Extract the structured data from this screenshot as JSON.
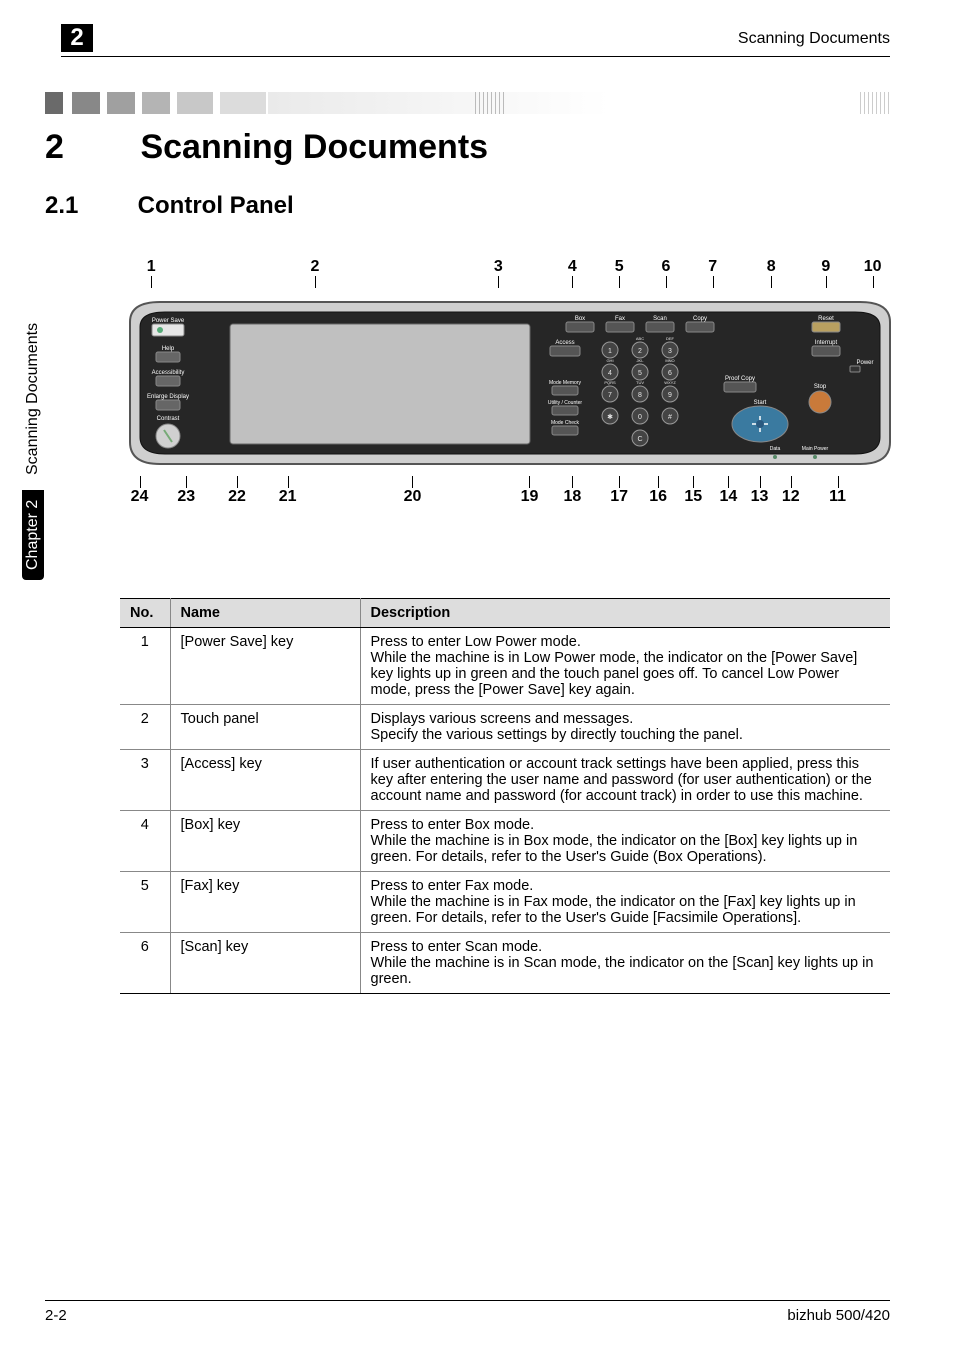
{
  "header": {
    "chapter_no": "2",
    "title_right": "Scanning Documents"
  },
  "sidebar": {
    "chapter_label": "Chapter 2",
    "section_title": "Scanning Documents"
  },
  "h1": {
    "num": "2",
    "text": "Scanning Documents"
  },
  "h2": {
    "num": "2.1",
    "text": "Control Panel"
  },
  "panel": {
    "top": [
      "1",
      "2",
      "3",
      "4",
      "5",
      "6",
      "7",
      "8",
      "9",
      "10"
    ],
    "bottom": [
      "24",
      "23",
      "22",
      "21",
      "20",
      "19",
      "18",
      "17",
      "16",
      "15",
      "14",
      "13",
      "12",
      "11"
    ],
    "buttons": {
      "power_save": "Power Save",
      "help": "Help",
      "accessibility": "Accessibility",
      "enlarge_display": "Enlarge Display",
      "contrast": "Contrast",
      "box": "Box",
      "fax": "Fax",
      "scan": "Scan",
      "copy": "Copy",
      "reset": "Reset",
      "access": "Access",
      "interrupt": "Interrupt",
      "power": "Power",
      "mode_memory": "Mode Memory",
      "utility": "Utility / Counter",
      "mode_check": "Mode Check",
      "proof_copy": "Proof Copy",
      "stop": "Stop",
      "start": "Start",
      "data": "Data",
      "main_power": "Main Power",
      "k1": "1",
      "k2": "2",
      "k3": "3",
      "k4": "4",
      "k5": "5",
      "k6": "6",
      "k7": "7",
      "k8": "8",
      "k9": "9",
      "k0": "0",
      "kstar": "✱",
      "khash": "#",
      "kc": "C",
      "a2": "ABC",
      "a3": "DEF",
      "a4": "GHI",
      "a5": "JKL",
      "a6": "MNO",
      "a7": "PQRS",
      "a8": "TUV",
      "a9": "WXYZ"
    }
  },
  "table": {
    "headers": {
      "no": "No.",
      "name": "Name",
      "desc": "Description"
    },
    "rows": [
      {
        "no": "1",
        "name": "[Power Save] key",
        "desc": "Press to enter Low Power mode.\nWhile the machine is in Low Power mode, the indicator on the [Power Save] key lights up in green and the touch panel goes off. To cancel Low Power mode, press the [Power Save] key again."
      },
      {
        "no": "2",
        "name": "Touch panel",
        "desc": "Displays various screens and messages.\nSpecify the various settings by directly touching the panel."
      },
      {
        "no": "3",
        "name": "[Access] key",
        "desc": "If user authentication or account track settings have been applied, press this key after entering the user name and password (for user authentication) or the account name and password (for account track) in order to use this machine."
      },
      {
        "no": "4",
        "name": "[Box] key",
        "desc": "Press to enter Box mode.\nWhile the machine is in Box mode, the indicator on the [Box] key lights up in green. For details, refer to the User's Guide (Box Operations)."
      },
      {
        "no": "5",
        "name": "[Fax] key",
        "desc": "Press to enter Fax mode.\nWhile the machine is in Fax mode, the indicator on the [Fax] key lights up in green. For details, refer to the User's Guide [Facsimile Operations]."
      },
      {
        "no": "6",
        "name": "[Scan] key",
        "desc": "Press to enter Scan mode.\nWhile the machine is in Scan mode, the indicator on the [Scan] key lights up in green."
      }
    ]
  },
  "footer": {
    "left": "2-2",
    "right": "bizhub 500/420"
  },
  "colors": {
    "deco": [
      "#6a6a6a",
      "#888888",
      "#a0a0a0",
      "#b4b4b4",
      "#c8c8c8",
      "#dcdcdc",
      "#f0f0f0"
    ]
  }
}
